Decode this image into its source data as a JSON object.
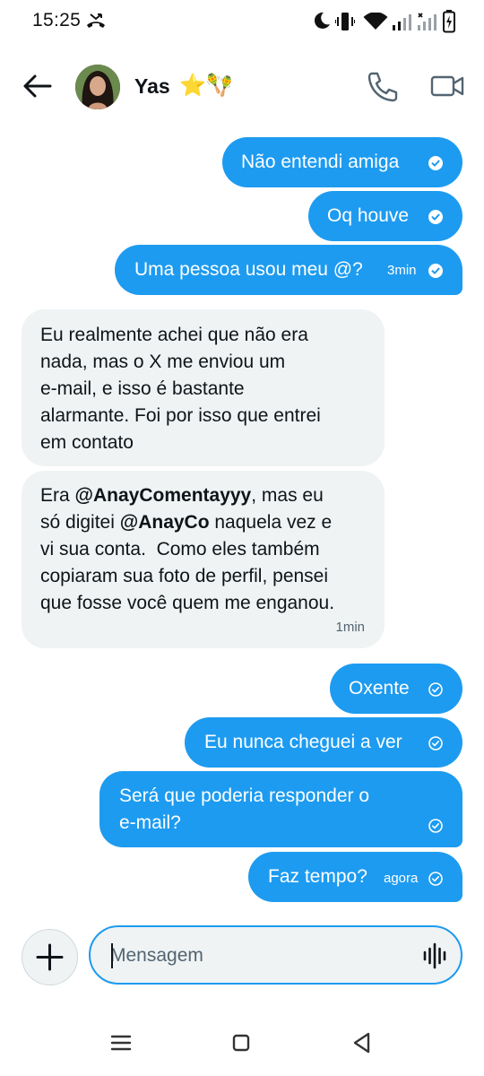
{
  "status_bar": {
    "time": "15:25",
    "icons": [
      "missed-call-icon",
      "do-not-disturb-moon-icon",
      "vibrate-icon",
      "wifi-icon",
      "signal-icon",
      "signal-no-sim-icon",
      "battery-charging-icon"
    ]
  },
  "header": {
    "contact_name": "Yas",
    "name_emojis": "⭐🪇",
    "back_icon": "arrow-left-icon",
    "call_icon": "phone-icon",
    "video_icon": "video-camera-icon"
  },
  "messages": [
    {
      "direction": "out",
      "text": "Não entendi amiga",
      "time": "",
      "status": "read"
    },
    {
      "direction": "out",
      "text": "Oq houve",
      "time": "",
      "status": "read"
    },
    {
      "direction": "out",
      "text": "Uma pessoa usou meu @?",
      "time": "3min",
      "status": "read"
    },
    {
      "direction": "in",
      "lines": [
        "Eu realmente achei que não era",
        "nada, mas o X me enviou um",
        "e-mail, e isso é bastante",
        "alarmante. Foi por isso que entrei",
        "em contato"
      ],
      "time": ""
    },
    {
      "direction": "in",
      "parts": {
        "p1": "Era ",
        "handle1": "@AnayComentayyy",
        "p2": ", mas eu",
        "p3": "só digitei ",
        "handle2": "@AnayCo",
        "p4": " naquela vez e",
        "l3": "vi sua conta.  Como eles também",
        "l4": "copiaram sua foto de perfil, pensei",
        "l5": "que fosse você quem me enganou."
      },
      "time": "1min"
    },
    {
      "direction": "out",
      "text": "Oxente",
      "time": "",
      "status": "sent"
    },
    {
      "direction": "out",
      "text": "Eu nunca cheguei a ver",
      "time": "",
      "status": "sent"
    },
    {
      "direction": "out",
      "lines": [
        "Será que poderia responder o",
        "e-mail?"
      ],
      "time": "",
      "status": "sent"
    },
    {
      "direction": "out",
      "text": "Faz tempo?",
      "time": "agora",
      "status": "sent"
    }
  ],
  "composer": {
    "placeholder": "Mensagem",
    "value": "",
    "plus_icon": "plus-icon",
    "voice_icon": "voice-waveform-icon"
  },
  "nav_bar": {
    "icons": [
      "recent-apps-icon",
      "home-icon",
      "back-triangle-icon"
    ]
  },
  "colors": {
    "accent": "#1d9bf0",
    "incoming_bubble": "#eff3f4",
    "text": "#0f1419",
    "muted": "#536471"
  }
}
